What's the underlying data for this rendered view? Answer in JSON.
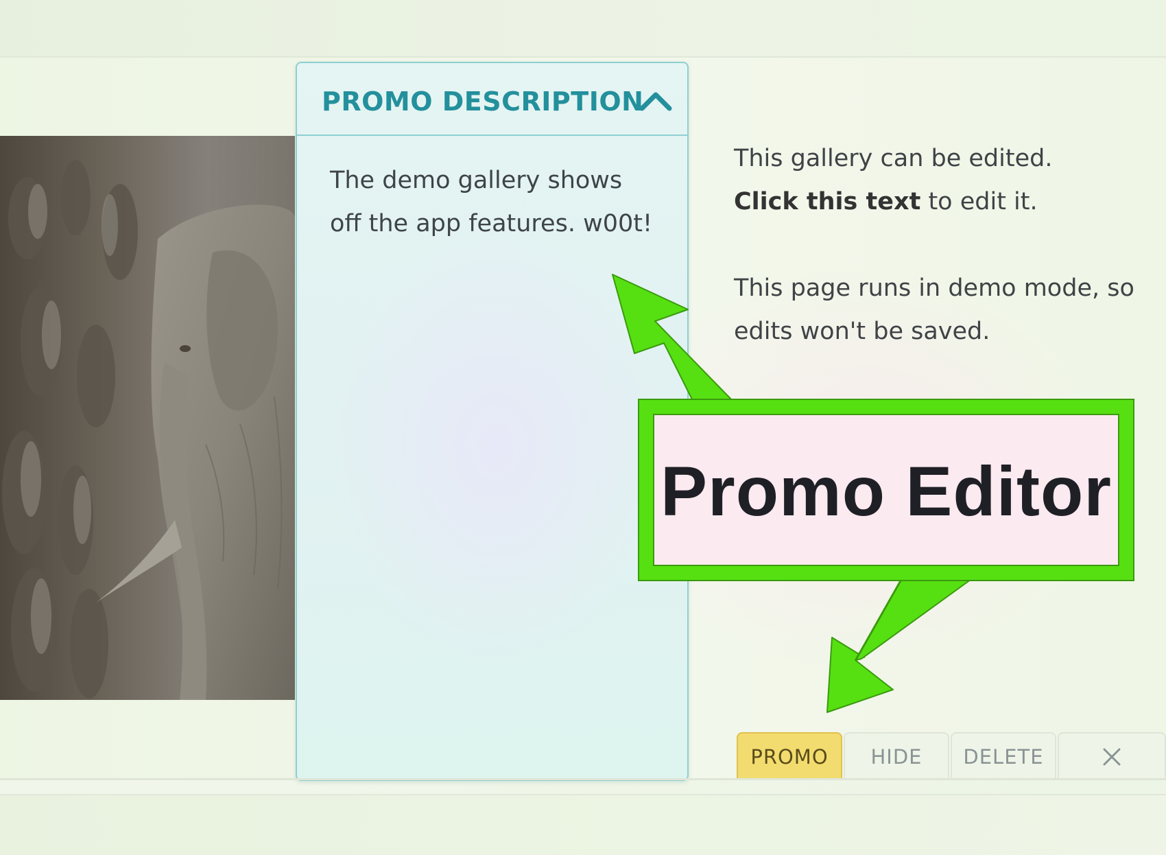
{
  "gallery": {
    "image_alt": "Stone relief carving with an elephant"
  },
  "promo_panel": {
    "title": "PROMO DESCRIPTION",
    "collapse_icon": "chevron-up-icon",
    "description": "The demo gallery shows off the app features. w00t!"
  },
  "side_text": {
    "line1": "This gallery can be edited.",
    "line2_bold": "Click this text",
    "line2_rest": " to edit it.",
    "paragraph2": "This page runs in demo mode, so edits won't be saved."
  },
  "annotation": {
    "label": "Promo Editor",
    "color": "#56e012"
  },
  "actions": {
    "promo": "PROMO",
    "hide": "HIDE",
    "delete": "DELETE",
    "close_icon": "close-icon"
  },
  "colors": {
    "accent": "#23909c",
    "active_tab": "#f3dc6f"
  }
}
